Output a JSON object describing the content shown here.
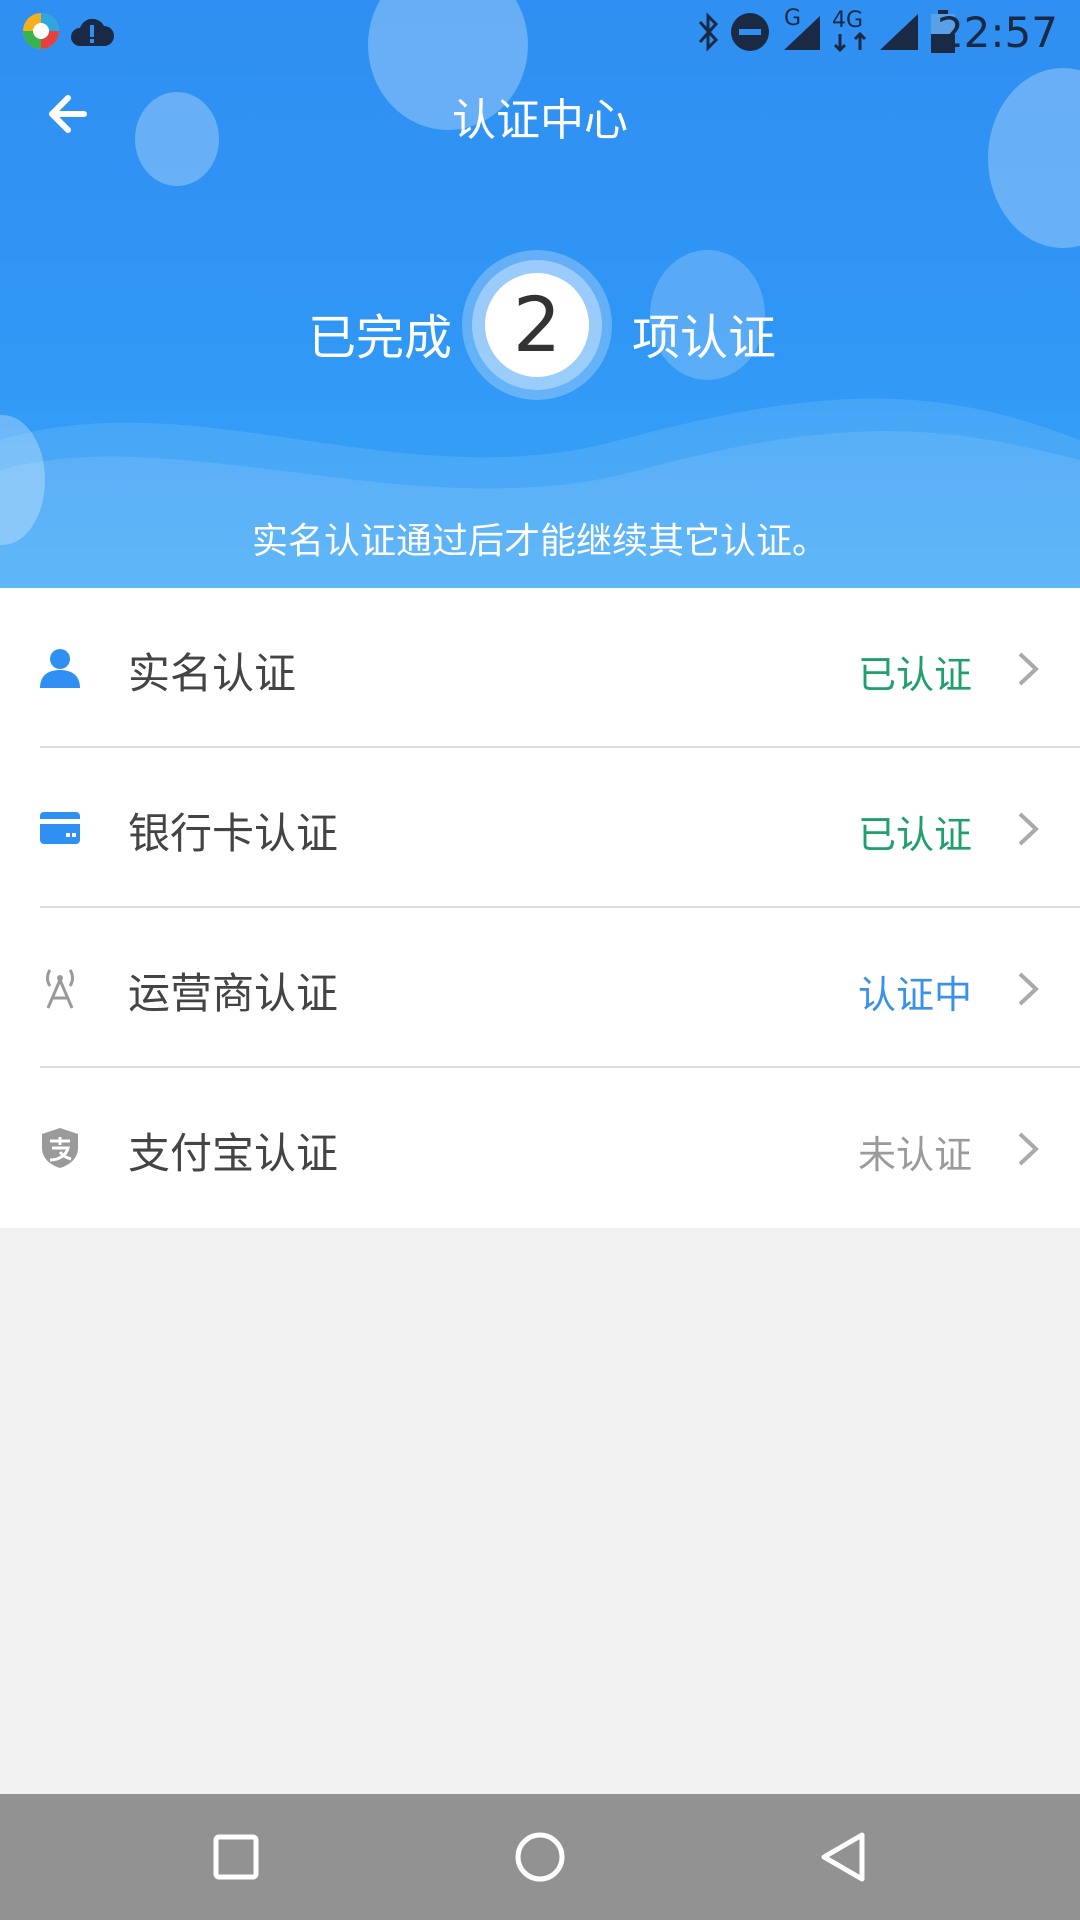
{
  "status_bar": {
    "time": "22:57",
    "network_g": "G",
    "network_4g": "4G",
    "icons": [
      "app-icon",
      "cloud-alert-icon",
      "bluetooth-icon",
      "dnd-icon",
      "signal-icon",
      "signal-icon",
      "battery-icon"
    ]
  },
  "header": {
    "title": "认证中心",
    "done_prefix": "已完成",
    "done_count": "2",
    "done_suffix": "项认证",
    "hint": "实名认证通过后才能继续其它认证。"
  },
  "items": [
    {
      "label": "实名认证",
      "status": "已认证",
      "status_color": "#1fa06b",
      "icon": "person-icon"
    },
    {
      "label": "银行卡认证",
      "status": "已认证",
      "status_color": "#1fa06b",
      "icon": "bank-card-icon"
    },
    {
      "label": "运营商认证",
      "status": "认证中",
      "status_color": "#3a91e6",
      "icon": "antenna-icon"
    },
    {
      "label": "支付宝认证",
      "status": "未认证",
      "status_color": "#9a9a9a",
      "icon": "alipay-shield-icon"
    }
  ],
  "colors": {
    "header_blue": "#2f8ff2",
    "green": "#1fa06b",
    "blue": "#3a91e6",
    "gray": "#9a9a9a"
  }
}
